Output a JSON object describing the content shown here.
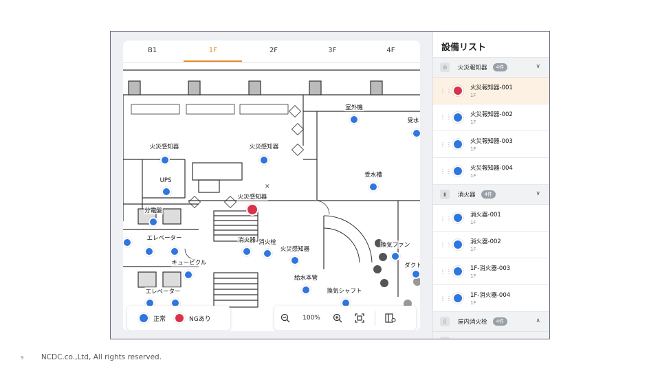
{
  "floor_tabs": [
    {
      "label": "B1",
      "active": false
    },
    {
      "label": "1F",
      "active": true
    },
    {
      "label": "2F",
      "active": false
    },
    {
      "label": "3F",
      "active": false
    },
    {
      "label": "4F",
      "active": false
    }
  ],
  "map_labels": {
    "outdoor_unit": "室外機",
    "receiving_cut": "受水",
    "fire_detector_a": "火災感知器",
    "fire_detector_b": "火災感知器",
    "ups": "UPS",
    "water_tank": "受水槽",
    "fire_detector_ng": "火災感知器",
    "distribution_board": "分電盤",
    "elevator_a": "エレベーター",
    "extinguisher": "消火器",
    "hydrant": "消火栓",
    "fire_detector_c": "火災感知器",
    "ventilation_fan": "換気ファン",
    "cubicle": "キュービクル",
    "duct": "ダクト",
    "water_supply_pipe": "給水本管",
    "elevator_b": "エレベーター",
    "exhaust_shaft": "換気シャフト"
  },
  "legend": {
    "normal": "正常",
    "ng": "NGあり"
  },
  "zoom": {
    "level": "100%"
  },
  "panel": {
    "title": "設備リスト",
    "groups": [
      {
        "name": "火災報知器",
        "count": "4件",
        "expanded": true,
        "items": [
          {
            "name": "火災報知器-001",
            "floor": "1F",
            "status": "ng"
          },
          {
            "name": "火災報知器-002",
            "floor": "1F",
            "status": "normal"
          },
          {
            "name": "火災報知器-003",
            "floor": "1F",
            "status": "normal"
          },
          {
            "name": "火災報知器-004",
            "floor": "1F",
            "status": "normal"
          }
        ]
      },
      {
        "name": "消火器",
        "count": "4件",
        "expanded": true,
        "items": [
          {
            "name": "消火器-001",
            "floor": "1F",
            "status": "normal"
          },
          {
            "name": "消火器-002",
            "floor": "1F",
            "status": "normal"
          },
          {
            "name": "1F-消火器-003",
            "floor": "1F",
            "status": "normal"
          },
          {
            "name": "1F-消火器-004",
            "floor": "1F",
            "status": "normal"
          }
        ]
      },
      {
        "name": "屋内消火栓",
        "count": "4件",
        "expanded": false,
        "items": []
      }
    ]
  },
  "colors": {
    "accent": "#e8862a",
    "normal": "#2f76de",
    "ng": "#d8334a"
  },
  "footer": {
    "page": "9",
    "copyright": "NCDC.co.,Ltd, All rights reserved."
  }
}
